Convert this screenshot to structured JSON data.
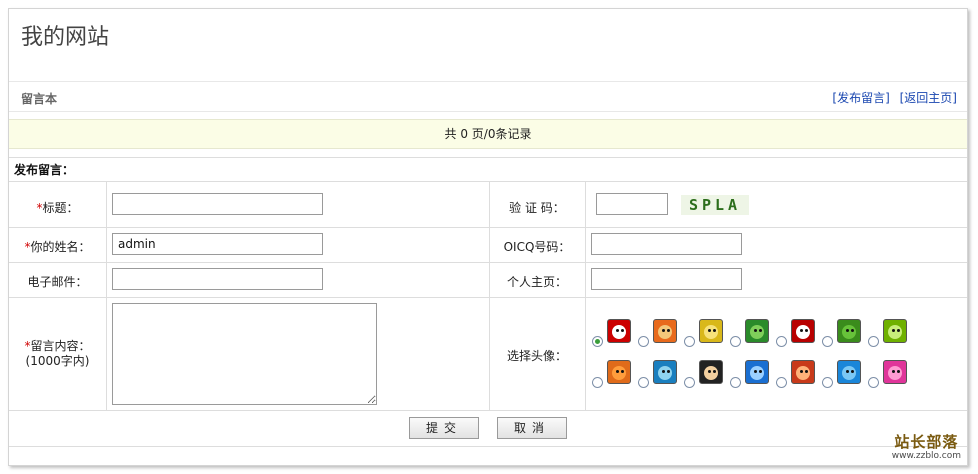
{
  "site": {
    "title": "我的网站"
  },
  "guestbook": {
    "title": "留言本",
    "links": [
      "[发布留言]",
      "[返回主页]"
    ],
    "pager_text": "共 0 页/0条记录",
    "form_heading": "发布留言："
  },
  "form": {
    "required_mark": "*",
    "labels": {
      "title": "标题：",
      "name": "你的姓名：",
      "email": "电子邮件：",
      "content_line1": "留言内容：",
      "content_line2": "(1000字内)",
      "captcha": "验 证 码：",
      "oicq": "OICQ号码：",
      "homepage": "个人主页：",
      "avatar": "选择头像："
    },
    "values": {
      "title": "",
      "name": "admin",
      "email": "",
      "content": "",
      "captcha_input": "",
      "oicq": "",
      "homepage": ""
    },
    "captcha_image_text": "SPLA",
    "selected_avatar": 1,
    "buttons": {
      "submit": "提交",
      "cancel": "取消"
    }
  },
  "watermark": {
    "cn": "站长部落",
    "url": "www.zzblo.com"
  },
  "colors": {
    "accent_link": "#1a47b0",
    "required": "#d00000",
    "pager_bg": "#fbfde6",
    "captcha_text": "#2c6e1c"
  }
}
